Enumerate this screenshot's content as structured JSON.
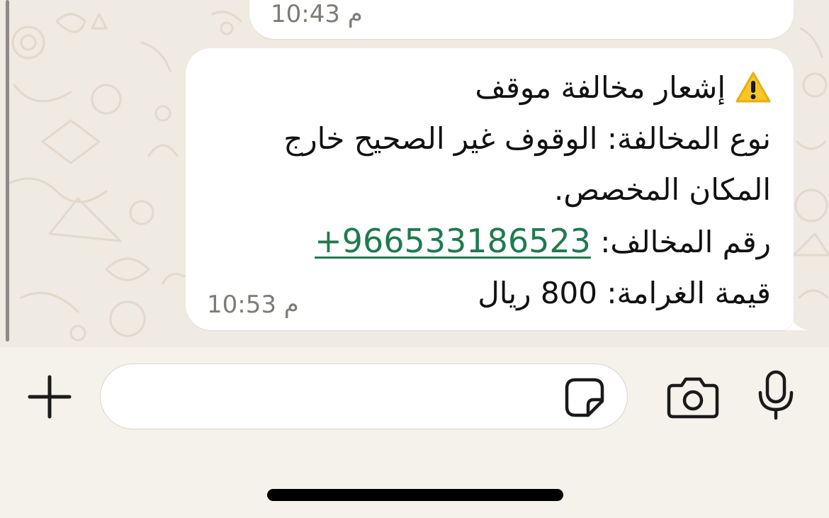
{
  "chat": {
    "previous_message": {
      "time": "10:43 م"
    },
    "message": {
      "warning_icon": "warning-sign-icon",
      "title": "إشعار مخالفة موقف",
      "violation_type_line1": "نوع المخالفة: الوقوف غير الصحيح خارج",
      "violation_type_line2": "المكان المخصص.",
      "violator_number_label": "رقم المخالف:",
      "violator_number": "+966533186523",
      "fine_label": "قيمة الغرامة:",
      "fine_amount": "800 ريال",
      "time": "10:53 م"
    }
  },
  "composer": {
    "input_value": "",
    "input_placeholder": "",
    "plus_icon": "plus-icon",
    "sticker_icon": "sticker-icon",
    "camera_icon": "camera-icon",
    "mic_icon": "microphone-icon"
  },
  "colors": {
    "chat_background": "#efeae2",
    "bubble": "#ffffff",
    "link": "#1f7a4d",
    "toolbar": "#f5f2ec",
    "timestamp": "#7f7b76"
  }
}
